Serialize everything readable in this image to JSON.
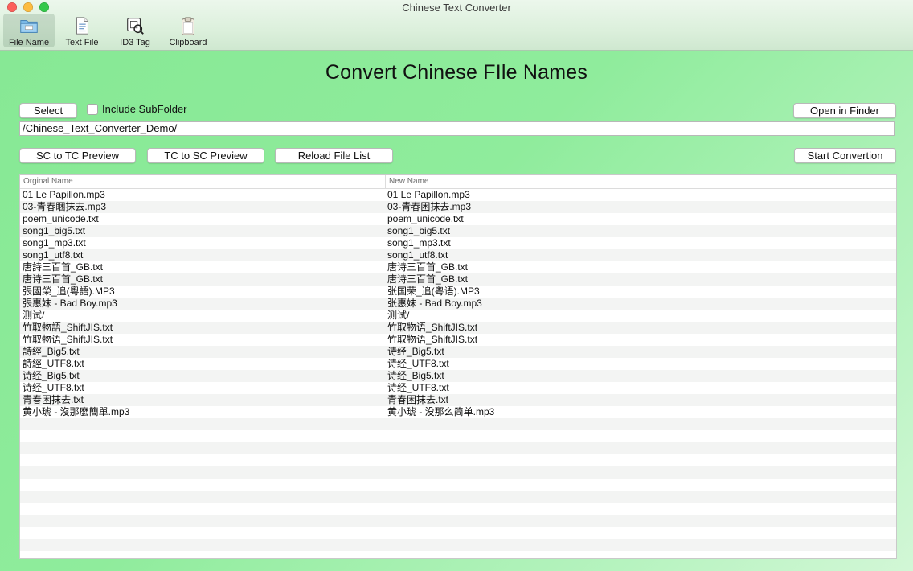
{
  "window": {
    "title": "Chinese Text Converter"
  },
  "toolbar": [
    {
      "label": "File Name",
      "icon": "folder-icon",
      "active": true
    },
    {
      "label": "Text File",
      "icon": "text-file-icon",
      "active": false
    },
    {
      "label": "ID3 Tag",
      "icon": "id3-tag-icon",
      "active": false
    },
    {
      "label": "Clipboard",
      "icon": "clipboard-icon",
      "active": false
    }
  ],
  "main": {
    "heading": "Convert Chinese FIle Names",
    "select_label": "Select",
    "include_subfolder_label": "Include SubFolder",
    "include_subfolder_checked": false,
    "open_in_finder_label": "Open in Finder",
    "path_value": "/Chinese_Text_Converter_Demo/",
    "sc_to_tc_label": "SC to TC Preview",
    "tc_to_sc_label": "TC to SC Preview",
    "reload_label": "Reload File List",
    "start_label": "Start Convertion"
  },
  "table": {
    "columns": [
      "Orginal Name",
      "New Name"
    ],
    "rows": [
      [
        "01 Le Papillon.mp3",
        "01 Le Papillon.mp3"
      ],
      [
        "03-青春睏抹去.mp3",
        "03-青春困抹去.mp3"
      ],
      [
        "poem_unicode.txt",
        "poem_unicode.txt"
      ],
      [
        "song1_big5.txt",
        "song1_big5.txt"
      ],
      [
        "song1_mp3.txt",
        "song1_mp3.txt"
      ],
      [
        "song1_utf8.txt",
        "song1_utf8.txt"
      ],
      [
        "唐詩三百首_GB.txt",
        "唐诗三百首_GB.txt"
      ],
      [
        "唐诗三百首_GB.txt",
        "唐诗三百首_GB.txt"
      ],
      [
        "張國榮_追(粵語).MP3",
        "张国荣_追(粤语).MP3"
      ],
      [
        "張惠妹 - Bad Boy.mp3",
        "张惠妹 - Bad Boy.mp3"
      ],
      [
        "测试/",
        "测试/"
      ],
      [
        "竹取物語_ShiftJIS.txt",
        "竹取物语_ShiftJIS.txt"
      ],
      [
        "竹取物语_ShiftJIS.txt",
        "竹取物语_ShiftJIS.txt"
      ],
      [
        "詩經_Big5.txt",
        "诗经_Big5.txt"
      ],
      [
        "詩經_UTF8.txt",
        "诗经_UTF8.txt"
      ],
      [
        "诗经_Big5.txt",
        "诗经_Big5.txt"
      ],
      [
        "诗经_UTF8.txt",
        "诗经_UTF8.txt"
      ],
      [
        "青春困抹去.txt",
        "青春困抹去.txt"
      ],
      [
        "黄小琥 - 沒那麼簡單.mp3",
        "黄小琥 - 没那么简单.mp3"
      ]
    ]
  }
}
